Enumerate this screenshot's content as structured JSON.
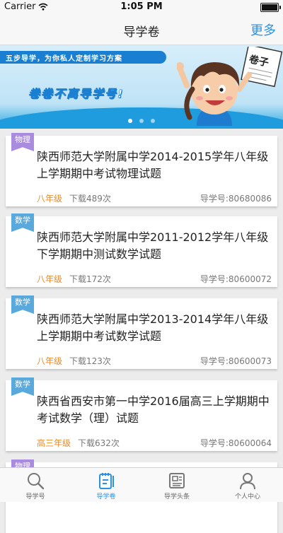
{
  "status_bar": {
    "carrier": "Carrier",
    "time": "1:05 PM"
  },
  "nav": {
    "title": "导学卷",
    "more": "更多"
  },
  "banner": {
    "tagline": "五步导学，为你私人定制学习方案",
    "slogan": "卷卷不离导学号!",
    "kid_sign": "卷子",
    "active_slide": 1,
    "slide_count": 3
  },
  "papers": [
    {
      "subject": "物理",
      "subject_color": "#a98be0",
      "title": "陕西师范大学附属中学2014-2015学年八年级上学期期中考试物理试题",
      "grade": "八年级",
      "downloads": "下载489次",
      "code": "导学号:80680086"
    },
    {
      "subject": "数学",
      "subject_color": "#5aa9dc",
      "title": "陕西师范大学附属中学2011-2012学年八年级下学期期中测试数学试题",
      "grade": "八年级",
      "downloads": "下载172次",
      "code": "导学号:80600072"
    },
    {
      "subject": "数学",
      "subject_color": "#5aa9dc",
      "title": "陕西师范大学附属中学2013-2014学年八年级上学期期中考试数学试题",
      "grade": "八年级",
      "downloads": "下载123次",
      "code": "导学号:80600073"
    },
    {
      "subject": "数学",
      "subject_color": "#5aa9dc",
      "title": "陕西省西安市第一中学2016届高三上学期期中考试数学（理）试题",
      "grade": "高三年级",
      "downloads": "下载632次",
      "code": "导学号:80600064"
    },
    {
      "subject": "物理",
      "subject_color": "#a98be0"
    }
  ],
  "tabs": [
    {
      "label": "导学号",
      "icon": "search-icon",
      "active": false
    },
    {
      "label": "导学卷",
      "icon": "notebook-icon",
      "active": true
    },
    {
      "label": "导学头条",
      "icon": "newspaper-icon",
      "active": false
    },
    {
      "label": "个人中心",
      "icon": "person-icon",
      "active": false
    }
  ],
  "colors": {
    "accent": "#2b91e6",
    "grade": "#f08a24",
    "banner_blue": "#1a7fd0"
  }
}
